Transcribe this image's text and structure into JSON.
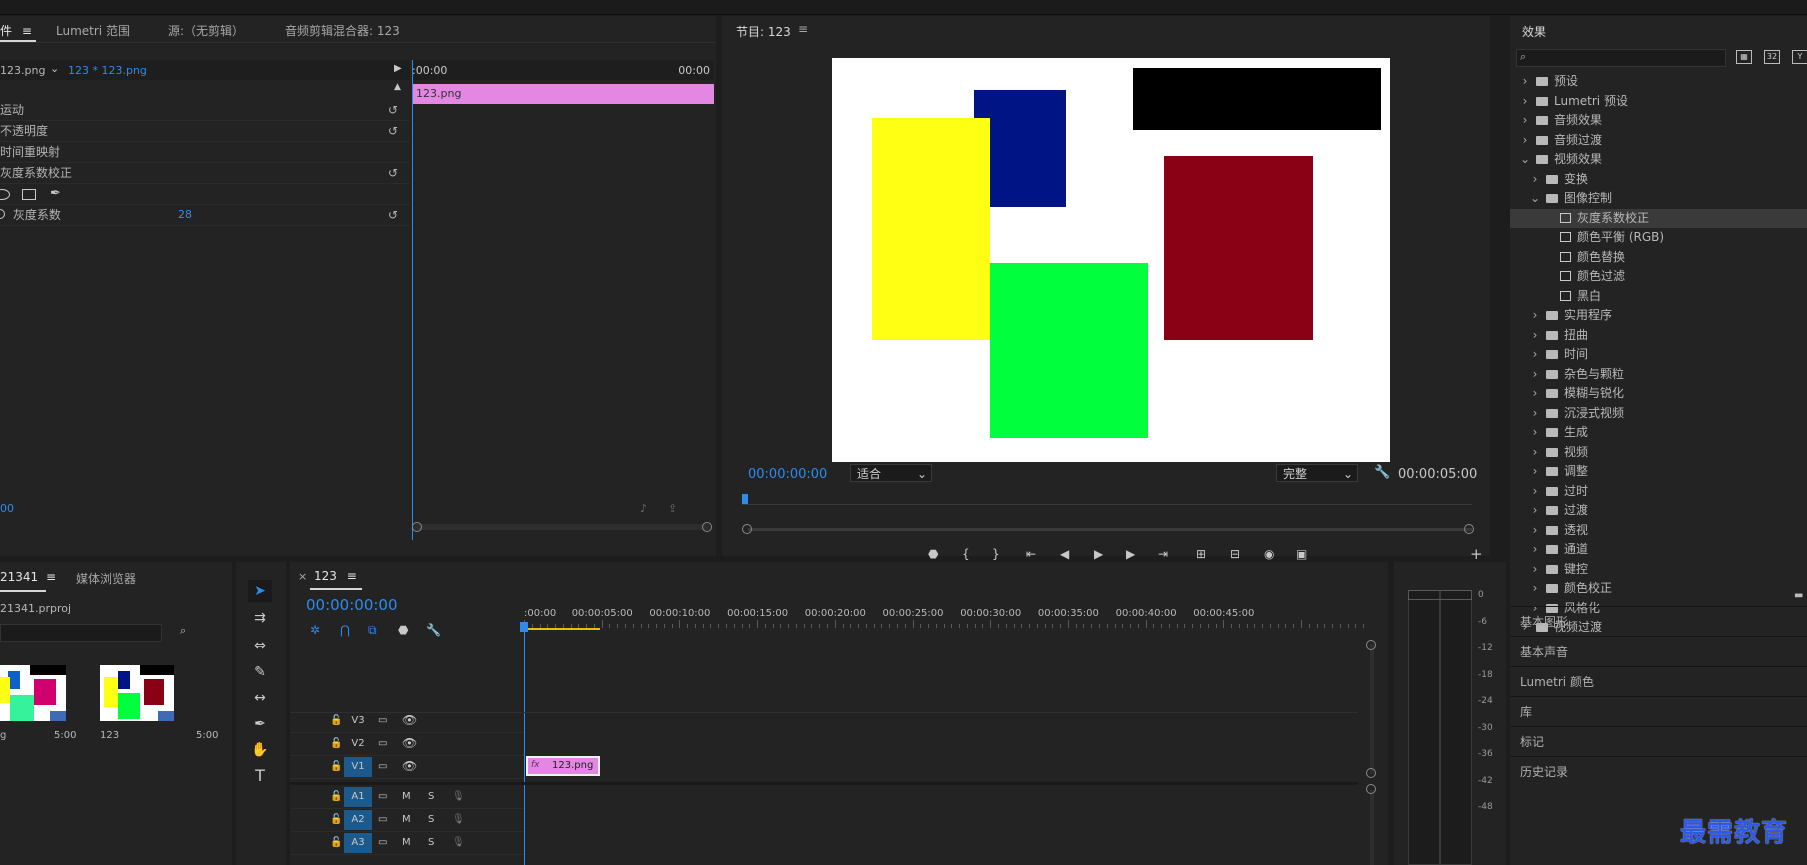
{
  "effect_controls": {
    "tabs": [
      "件",
      "Lumetri 范围",
      "源:（无剪辑）",
      "音频剪辑混合器: 123"
    ],
    "source_label": "123.png",
    "clip_label": "123 * 123.png",
    "time_start": ":00:00",
    "time_end": "00:00",
    "clip_bar_label": "123.png",
    "rows": [
      {
        "label": "运动"
      },
      {
        "label": "不透明度"
      },
      {
        "label": "时间重映射"
      },
      {
        "label": "灰度系数校正"
      },
      {
        "label": "灰度系数",
        "value": "28"
      }
    ],
    "bottom_time": "00"
  },
  "program": {
    "title": "节目: 123",
    "timecode": "00:00:00:00",
    "fit": "适合",
    "quality": "完整",
    "duration": "00:00:05:00",
    "colors": {
      "yellow": "#ffff14",
      "navy": "#001486",
      "black": "#000000",
      "maroon": "#8a0014",
      "green": "#00ff3c"
    }
  },
  "effects": {
    "title": "效果",
    "search_placeholder": "",
    "items": [
      {
        "label": "预设",
        "level": 0,
        "kind": "preset"
      },
      {
        "label": "Lumetri 预设",
        "level": 0,
        "kind": "preset"
      },
      {
        "label": "音频效果",
        "level": 0,
        "kind": "folder"
      },
      {
        "label": "音频过渡",
        "level": 0,
        "kind": "folder"
      },
      {
        "label": "视频效果",
        "level": 0,
        "kind": "folder",
        "open": true
      },
      {
        "label": "变换",
        "level": 1,
        "kind": "folder"
      },
      {
        "label": "图像控制",
        "level": 1,
        "kind": "folder",
        "open": true
      },
      {
        "label": "灰度系数校正",
        "level": 2,
        "kind": "fx",
        "selected": true
      },
      {
        "label": "颜色平衡 (RGB)",
        "level": 2,
        "kind": "fx"
      },
      {
        "label": "颜色替换",
        "level": 2,
        "kind": "fx"
      },
      {
        "label": "颜色过滤",
        "level": 2,
        "kind": "fx"
      },
      {
        "label": "黑白",
        "level": 2,
        "kind": "fx"
      },
      {
        "label": "实用程序",
        "level": 1,
        "kind": "folder"
      },
      {
        "label": "扭曲",
        "level": 1,
        "kind": "folder"
      },
      {
        "label": "时间",
        "level": 1,
        "kind": "folder"
      },
      {
        "label": "杂色与颗粒",
        "level": 1,
        "kind": "folder"
      },
      {
        "label": "模糊与锐化",
        "level": 1,
        "kind": "folder"
      },
      {
        "label": "沉浸式视频",
        "level": 1,
        "kind": "folder"
      },
      {
        "label": "生成",
        "level": 1,
        "kind": "folder"
      },
      {
        "label": "视频",
        "level": 1,
        "kind": "folder"
      },
      {
        "label": "调整",
        "level": 1,
        "kind": "folder"
      },
      {
        "label": "过时",
        "level": 1,
        "kind": "folder"
      },
      {
        "label": "过渡",
        "level": 1,
        "kind": "folder"
      },
      {
        "label": "透视",
        "level": 1,
        "kind": "folder"
      },
      {
        "label": "通道",
        "level": 1,
        "kind": "folder"
      },
      {
        "label": "键控",
        "level": 1,
        "kind": "folder"
      },
      {
        "label": "颜色校正",
        "level": 1,
        "kind": "folder"
      },
      {
        "label": "风格化",
        "level": 1,
        "kind": "folder"
      },
      {
        "label": "视频过渡",
        "level": 0,
        "kind": "folder"
      }
    ],
    "panels": [
      "基本图形",
      "基本声音",
      "Lumetri 颜色",
      "库",
      "标记",
      "历史记录"
    ]
  },
  "project": {
    "tabs": [
      "21341",
      "媒体浏览器"
    ],
    "file": "21341.prproj",
    "items": [
      {
        "name": "g",
        "duration": "5:00"
      },
      {
        "name": "123",
        "duration": "5:00"
      }
    ]
  },
  "timeline": {
    "sequence": "123",
    "timecode": "00:00:00:00",
    "ruler": [
      ":00:00",
      "00:00:05:00",
      "00:00:10:00",
      "00:00:15:00",
      "00:00:20:00",
      "00:00:25:00",
      "00:00:30:00",
      "00:00:35:00",
      "00:00:40:00",
      "00:00:45:00"
    ],
    "video_tracks": [
      "V3",
      "V2",
      "V1"
    ],
    "audio_tracks": [
      "A1",
      "A2",
      "A3"
    ],
    "mute": "M",
    "solo": "S",
    "clip_label": "123.png",
    "clip_fx": "fx"
  },
  "meter": {
    "scale": [
      "0",
      "-6",
      "-12",
      "-18",
      "-24",
      "-30",
      "-36",
      "-42",
      "-48"
    ]
  },
  "watermark": "最需教育"
}
